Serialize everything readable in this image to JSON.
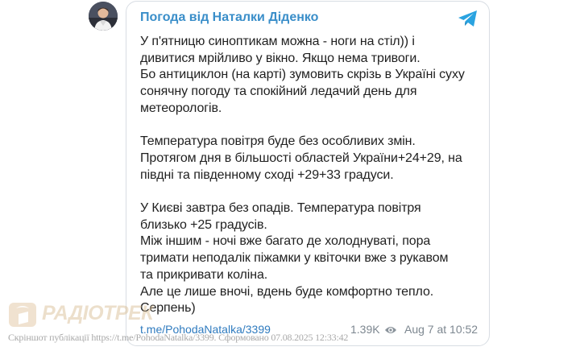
{
  "post": {
    "channel_name": "Погода від Наталки Діденко",
    "message": {
      "paragraphs": [
        [
          "У п'ятницю синоптикам можна - ноги на стіл)) і",
          "дивитися мрійливо у вікно. Якщо нема тривоги.",
          "Бо антициклон (на карті) зумовить скрізь в Україні суху",
          "сонячну погоду та спокійний ледачий день для",
          "метеорологів."
        ],
        [
          "Температура повітря буде без особливих змін.",
          "Протягом дня в більшості областей України+24+29, на",
          "півдні та південному сході +29+33 градуси."
        ],
        [
          "У Києві завтра без опадів. Температура повітря",
          "близько +25 градусів.",
          "Між іншим - ночі вже багато де холоднуваті, пора",
          "тримати неподалік піжамки у квіточки вже з рукавом",
          "та прикривати коліна.",
          "Але це лише вночі, вдень буде комфортно тепло.",
          "Серпень)"
        ]
      ]
    },
    "link": "t.me/PohodaNatalka/3399",
    "views": "1.39K",
    "date": "Aug 7 at 10:52",
    "icons": {
      "platform": "telegram-icon",
      "views": "eye-icon"
    }
  },
  "watermark": {
    "logo_text": "РАДІОТРЕК",
    "caption": "Скріншот публікації https://t.me/PohodaNatalka/3399. Сформовано 07.08.2025 12:33:42"
  },
  "colors": {
    "channel_name": "#3a8ec9",
    "link": "#2f7bbf",
    "meta": "#7d8790",
    "telegram": "#2aa3e0",
    "card_border": "#d8dde3"
  }
}
